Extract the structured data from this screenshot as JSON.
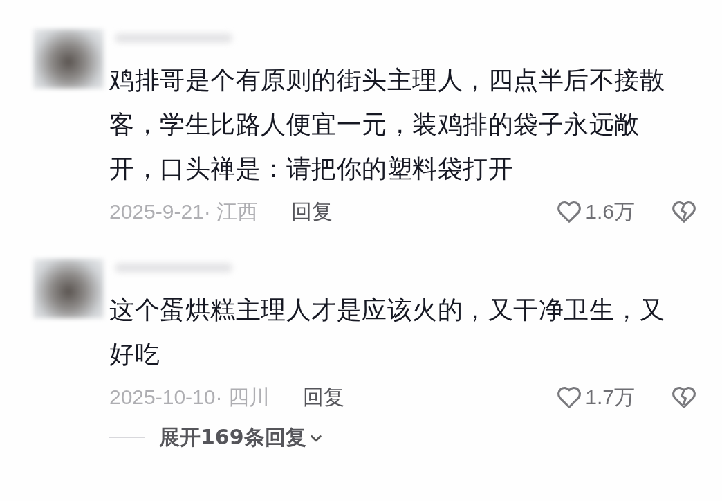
{
  "comments": [
    {
      "text": "鸡排哥是个有原则的街头主理人，四点半后不接散客，学生比路人便宜一元，装鸡排的袋子永远敞开，口头禅是：请把你的塑料袋打开",
      "date": "2025-9-21·",
      "location": "江西",
      "reply_label": "回复",
      "likes": "1.6万",
      "liked": false
    },
    {
      "text": "这个蛋烘糕主理人才是应该火的，又干净卫生，又好吃",
      "date": "2025-10-10·",
      "location": "四川",
      "reply_label": "回复",
      "likes": "1.7万",
      "liked": false,
      "expand_replies": "展开169条回复"
    }
  ]
}
